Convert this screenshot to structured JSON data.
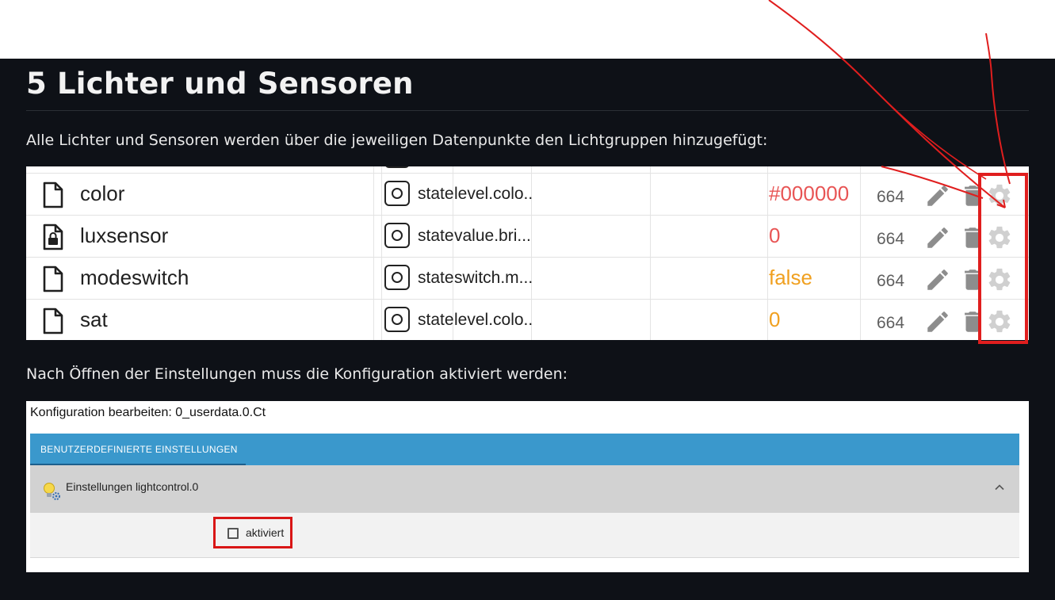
{
  "heading": "5 Lichter und Sensoren",
  "intro_text": "Alle Lichter und Sensoren werden über die jeweiligen Datenpunkte den Lichtgruppen hinzugefügt:",
  "objects": {
    "rows": [
      {
        "name": "color",
        "role": "state",
        "role_value": "level.colo...",
        "value": "#000000",
        "value_color": "#e85555",
        "acl": "664",
        "locked": false
      },
      {
        "name": "luxsensor",
        "role": "state",
        "role_value": "value.bri...",
        "value": "0",
        "value_color": "#e85555",
        "acl": "664",
        "locked": true
      },
      {
        "name": "modeswitch",
        "role": "state",
        "role_value": "switch.m...",
        "value": "false",
        "value_color": "#f0a020",
        "acl": "664",
        "locked": false
      },
      {
        "name": "sat",
        "role": "state",
        "role_value": "level.colo...",
        "value": "0",
        "value_color": "#f0a020",
        "acl": "664",
        "locked": false
      }
    ]
  },
  "after_text": "Nach Öffnen der Einstellungen muss die Konfiguration aktiviert werden:",
  "config": {
    "title": "Konfiguration bearbeiten: 0_userdata.0.Ct",
    "tab_label": "BENUTZERDEFINIERTE EINSTELLUNGEN",
    "section_label": "Einstellungen lightcontrol.0",
    "checkbox_label": "aktiviert",
    "checkbox_checked": false
  },
  "colors": {
    "background_dark": "#0e1117",
    "tab_blue": "#3a98cc",
    "highlight_red": "#e01e1e"
  },
  "icons": [
    "file-icon",
    "locked-file-icon",
    "state-type-icon",
    "edit-icon",
    "delete-icon",
    "settings-gear-icon",
    "bulb-settings-icon",
    "chevron-up-icon"
  ]
}
